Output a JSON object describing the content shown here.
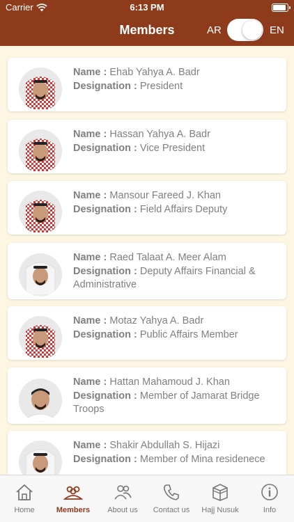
{
  "status": {
    "carrier": "Carrier",
    "time": "6:13 PM",
    "battery_level": 0.95
  },
  "nav": {
    "title": "Members",
    "lang_left": "AR",
    "lang_right": "EN",
    "toggle_on": true
  },
  "labels": {
    "name": "Name :",
    "designation": "Designation :"
  },
  "members": [
    {
      "name": "Ehab Yahya A. Badr",
      "designation": "President",
      "headwear": "red-check"
    },
    {
      "name": "Hassan Yahya A. Badr",
      "designation": "Vice President",
      "headwear": "red-check"
    },
    {
      "name": "Mansour Fareed J. Khan",
      "designation": "Field Affairs Deputy",
      "headwear": "red-check"
    },
    {
      "name": "Raed Talaat A. Meer Alam",
      "designation": "Deputy Affairs Financial & Administrative",
      "headwear": "white"
    },
    {
      "name": "Motaz Yahya A. Badr",
      "designation": "Public Affairs Member",
      "headwear": "red-check"
    },
    {
      "name": "Hattan Mahamoud J. Khan",
      "designation": "Member of Jamarat Bridge Troops",
      "headwear": "none"
    },
    {
      "name": "Shakir Abdullah S. Hijazi",
      "designation": "Member of Mina residenece",
      "headwear": "white"
    }
  ],
  "tabs": [
    {
      "label": "Home",
      "icon": "home-icon",
      "active": false
    },
    {
      "label": "Members",
      "icon": "members-icon",
      "active": true
    },
    {
      "label": "About us",
      "icon": "about-us-icon",
      "active": false
    },
    {
      "label": "Contact us",
      "icon": "phone-icon",
      "active": false
    },
    {
      "label": "Hajj Nusuk",
      "icon": "kaaba-icon",
      "active": false
    },
    {
      "label": "Info",
      "icon": "info-icon",
      "active": false
    }
  ],
  "colors": {
    "brand": "#8e3b1c",
    "background": "#fdf6e3",
    "text_gray": "#808080"
  }
}
